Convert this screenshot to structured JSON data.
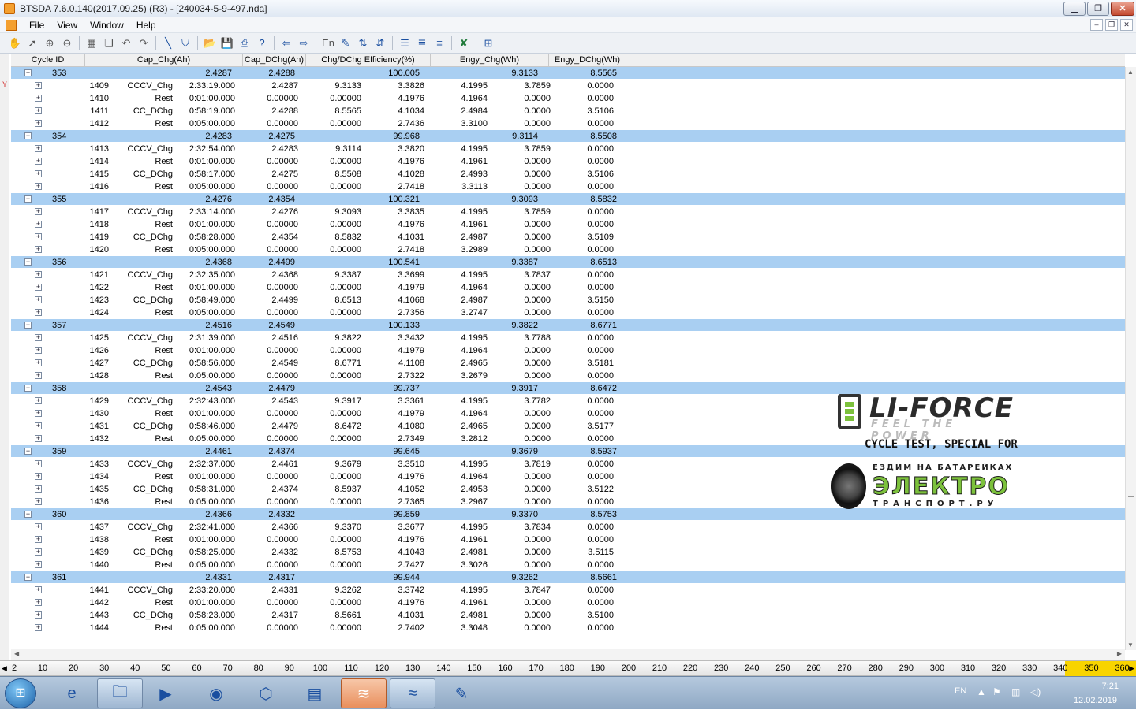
{
  "window": {
    "title": "BTSDA 7.6.0.140(2017.09.25) (R3) - [240034-5-9-497.nda]",
    "min": "▁",
    "max": "❐",
    "close": "✕"
  },
  "menu": [
    "File",
    "View",
    "Window",
    "Help"
  ],
  "mdi": {
    "min": "–",
    "restore": "❐",
    "close": "✕"
  },
  "left_marker": "Y",
  "headers": [
    "Cycle ID",
    "Cap_Chg(Ah)",
    "Cap_DChg(Ah)",
    "Chg/DChg Efficiency(%)",
    "Engy_Chg(Wh)",
    "Engy_DChg(Wh)"
  ],
  "cycles": [
    {
      "id": "353",
      "cap_chg": "2.4287",
      "cap_dchg": "2.4288",
      "eff": "100.005",
      "engy_chg": "9.3133",
      "engy_dchg": "8.5565",
      "steps": [
        [
          "1409",
          "CCCV_Chg",
          "2:33:19.000",
          "2.4287",
          "9.3133",
          "3.3826",
          "4.1995",
          "3.7859",
          "0.0000"
        ],
        [
          "1410",
          "Rest",
          "0:01:00.000",
          "0.00000",
          "0.00000",
          "4.1976",
          "4.1964",
          "0.0000",
          "0.0000"
        ],
        [
          "1411",
          "CC_DChg",
          "0:58:19.000",
          "2.4288",
          "8.5565",
          "4.1034",
          "2.4984",
          "0.0000",
          "3.5106"
        ],
        [
          "1412",
          "Rest",
          "0:05:00.000",
          "0.00000",
          "0.00000",
          "2.7436",
          "3.3100",
          "0.0000",
          "0.0000"
        ]
      ]
    },
    {
      "id": "354",
      "cap_chg": "2.4283",
      "cap_dchg": "2.4275",
      "eff": "99.968",
      "engy_chg": "9.3114",
      "engy_dchg": "8.5508",
      "steps": [
        [
          "1413",
          "CCCV_Chg",
          "2:32:54.000",
          "2.4283",
          "9.3114",
          "3.3820",
          "4.1995",
          "3.7859",
          "0.0000"
        ],
        [
          "1414",
          "Rest",
          "0:01:00.000",
          "0.00000",
          "0.00000",
          "4.1976",
          "4.1961",
          "0.0000",
          "0.0000"
        ],
        [
          "1415",
          "CC_DChg",
          "0:58:17.000",
          "2.4275",
          "8.5508",
          "4.1028",
          "2.4993",
          "0.0000",
          "3.5106"
        ],
        [
          "1416",
          "Rest",
          "0:05:00.000",
          "0.00000",
          "0.00000",
          "2.7418",
          "3.3113",
          "0.0000",
          "0.0000"
        ]
      ]
    },
    {
      "id": "355",
      "cap_chg": "2.4276",
      "cap_dchg": "2.4354",
      "eff": "100.321",
      "engy_chg": "9.3093",
      "engy_dchg": "8.5832",
      "steps": [
        [
          "1417",
          "CCCV_Chg",
          "2:33:14.000",
          "2.4276",
          "9.3093",
          "3.3835",
          "4.1995",
          "3.7859",
          "0.0000"
        ],
        [
          "1418",
          "Rest",
          "0:01:00.000",
          "0.00000",
          "0.00000",
          "4.1976",
          "4.1961",
          "0.0000",
          "0.0000"
        ],
        [
          "1419",
          "CC_DChg",
          "0:58:28.000",
          "2.4354",
          "8.5832",
          "4.1031",
          "2.4987",
          "0.0000",
          "3.5109"
        ],
        [
          "1420",
          "Rest",
          "0:05:00.000",
          "0.00000",
          "0.00000",
          "2.7418",
          "3.2989",
          "0.0000",
          "0.0000"
        ]
      ]
    },
    {
      "id": "356",
      "cap_chg": "2.4368",
      "cap_dchg": "2.4499",
      "eff": "100.541",
      "engy_chg": "9.3387",
      "engy_dchg": "8.6513",
      "steps": [
        [
          "1421",
          "CCCV_Chg",
          "2:32:35.000",
          "2.4368",
          "9.3387",
          "3.3699",
          "4.1995",
          "3.7837",
          "0.0000"
        ],
        [
          "1422",
          "Rest",
          "0:01:00.000",
          "0.00000",
          "0.00000",
          "4.1979",
          "4.1964",
          "0.0000",
          "0.0000"
        ],
        [
          "1423",
          "CC_DChg",
          "0:58:49.000",
          "2.4499",
          "8.6513",
          "4.1068",
          "2.4987",
          "0.0000",
          "3.5150"
        ],
        [
          "1424",
          "Rest",
          "0:05:00.000",
          "0.00000",
          "0.00000",
          "2.7356",
          "3.2747",
          "0.0000",
          "0.0000"
        ]
      ]
    },
    {
      "id": "357",
      "cap_chg": "2.4516",
      "cap_dchg": "2.4549",
      "eff": "100.133",
      "engy_chg": "9.3822",
      "engy_dchg": "8.6771",
      "steps": [
        [
          "1425",
          "CCCV_Chg",
          "2:31:39.000",
          "2.4516",
          "9.3822",
          "3.3432",
          "4.1995",
          "3.7788",
          "0.0000"
        ],
        [
          "1426",
          "Rest",
          "0:01:00.000",
          "0.00000",
          "0.00000",
          "4.1979",
          "4.1964",
          "0.0000",
          "0.0000"
        ],
        [
          "1427",
          "CC_DChg",
          "0:58:56.000",
          "2.4549",
          "8.6771",
          "4.1108",
          "2.4965",
          "0.0000",
          "3.5181"
        ],
        [
          "1428",
          "Rest",
          "0:05:00.000",
          "0.00000",
          "0.00000",
          "2.7322",
          "3.2679",
          "0.0000",
          "0.0000"
        ]
      ]
    },
    {
      "id": "358",
      "cap_chg": "2.4543",
      "cap_dchg": "2.4479",
      "eff": "99.737",
      "engy_chg": "9.3917",
      "engy_dchg": "8.6472",
      "steps": [
        [
          "1429",
          "CCCV_Chg",
          "2:32:43.000",
          "2.4543",
          "9.3917",
          "3.3361",
          "4.1995",
          "3.7782",
          "0.0000"
        ],
        [
          "1430",
          "Rest",
          "0:01:00.000",
          "0.00000",
          "0.00000",
          "4.1979",
          "4.1964",
          "0.0000",
          "0.0000"
        ],
        [
          "1431",
          "CC_DChg",
          "0:58:46.000",
          "2.4479",
          "8.6472",
          "4.1080",
          "2.4965",
          "0.0000",
          "3.5177"
        ],
        [
          "1432",
          "Rest",
          "0:05:00.000",
          "0.00000",
          "0.00000",
          "2.7349",
          "3.2812",
          "0.0000",
          "0.0000"
        ]
      ]
    },
    {
      "id": "359",
      "cap_chg": "2.4461",
      "cap_dchg": "2.4374",
      "eff": "99.645",
      "engy_chg": "9.3679",
      "engy_dchg": "8.5937",
      "steps": [
        [
          "1433",
          "CCCV_Chg",
          "2:32:37.000",
          "2.4461",
          "9.3679",
          "3.3510",
          "4.1995",
          "3.7819",
          "0.0000"
        ],
        [
          "1434",
          "Rest",
          "0:01:00.000",
          "0.00000",
          "0.00000",
          "4.1976",
          "4.1964",
          "0.0000",
          "0.0000"
        ],
        [
          "1435",
          "CC_DChg",
          "0:58:31.000",
          "2.4374",
          "8.5937",
          "4.1052",
          "2.4953",
          "0.0000",
          "3.5122"
        ],
        [
          "1436",
          "Rest",
          "0:05:00.000",
          "0.00000",
          "0.00000",
          "2.7365",
          "3.2967",
          "0.0000",
          "0.0000"
        ]
      ]
    },
    {
      "id": "360",
      "cap_chg": "2.4366",
      "cap_dchg": "2.4332",
      "eff": "99.859",
      "engy_chg": "9.3370",
      "engy_dchg": "8.5753",
      "steps": [
        [
          "1437",
          "CCCV_Chg",
          "2:32:41.000",
          "2.4366",
          "9.3370",
          "3.3677",
          "4.1995",
          "3.7834",
          "0.0000"
        ],
        [
          "1438",
          "Rest",
          "0:01:00.000",
          "0.00000",
          "0.00000",
          "4.1976",
          "4.1961",
          "0.0000",
          "0.0000"
        ],
        [
          "1439",
          "CC_DChg",
          "0:58:25.000",
          "2.4332",
          "8.5753",
          "4.1043",
          "2.4981",
          "0.0000",
          "3.5115"
        ],
        [
          "1440",
          "Rest",
          "0:05:00.000",
          "0.00000",
          "0.00000",
          "2.7427",
          "3.3026",
          "0.0000",
          "0.0000"
        ]
      ]
    },
    {
      "id": "361",
      "cap_chg": "2.4331",
      "cap_dchg": "2.4317",
      "eff": "99.944",
      "engy_chg": "9.3262",
      "engy_dchg": "8.5661",
      "steps": [
        [
          "1441",
          "CCCV_Chg",
          "2:33:20.000",
          "2.4331",
          "9.3262",
          "3.3742",
          "4.1995",
          "3.7847",
          "0.0000"
        ],
        [
          "1442",
          "Rest",
          "0:01:00.000",
          "0.00000",
          "0.00000",
          "4.1976",
          "4.1961",
          "0.0000",
          "0.0000"
        ],
        [
          "1443",
          "CC_DChg",
          "0:58:23.000",
          "2.4317",
          "8.5661",
          "4.1031",
          "2.4981",
          "0.0000",
          "3.5100"
        ],
        [
          "1444",
          "Rest",
          "0:05:00.000",
          "0.00000",
          "0.00000",
          "2.7402",
          "3.3048",
          "0.0000",
          "0.0000"
        ]
      ]
    }
  ],
  "ruler": [
    "2",
    "10",
    "20",
    "30",
    "40",
    "50",
    "60",
    "70",
    "80",
    "90",
    "100",
    "110",
    "120",
    "130",
    "140",
    "150",
    "160",
    "170",
    "180",
    "190",
    "200",
    "210",
    "220",
    "230",
    "240",
    "250",
    "260",
    "270",
    "280",
    "290",
    "300",
    "310",
    "320",
    "330",
    "340",
    "350",
    "360"
  ],
  "logo": {
    "brand": "LI-FORCE",
    "tagline": "FEEL THE POWER",
    "cycle": "CYCLE TEST, SPECIAL FOR",
    "ezdim": "ЕЗДИМ НА БАТАРЕЙКАХ",
    "elektro": "ЭЛЕКТРО",
    "transport": "ТРАНСПОРТ.РУ"
  },
  "tray": {
    "lang": "EN",
    "time": "7:21",
    "date": "12.02.2019"
  },
  "colors": {
    "cycle_row": "#a9cff2",
    "ruler_highlight": "#f8d400",
    "logo_green": "#7cc13c"
  }
}
